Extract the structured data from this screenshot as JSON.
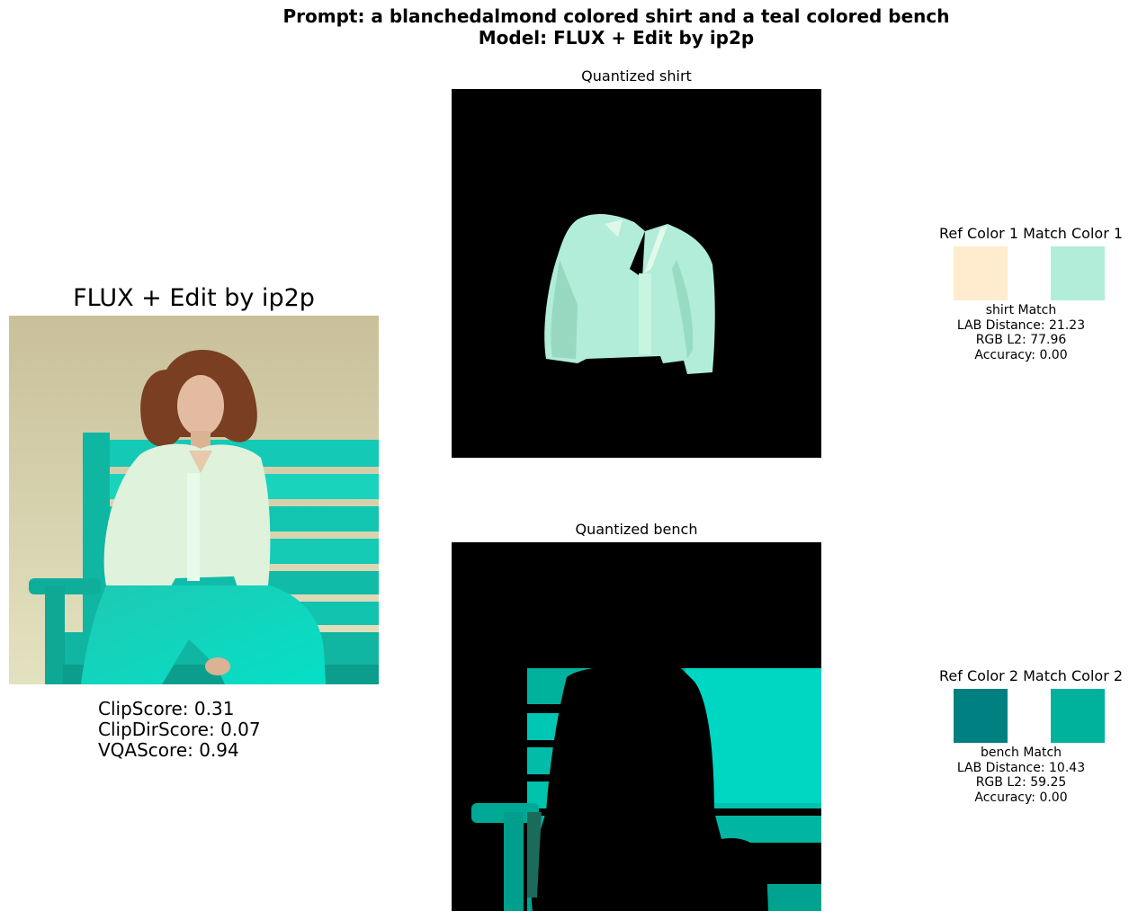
{
  "header": {
    "prompt_line": "Prompt: a blanchedalmond colored shirt and a teal colored bench",
    "model_line": "Model: FLUX + Edit by ip2p"
  },
  "left_panel": {
    "title": "FLUX + Edit by ip2p",
    "scores": [
      "ClipScore: 0.31",
      "ClipDirScore: 0.07",
      "VQAScore: 0.94"
    ]
  },
  "quantized": {
    "shirt_title": "Quantized shirt",
    "bench_title": "Quantized bench"
  },
  "colors": {
    "blanchedalmond": "#FFEBCD",
    "shirt_match": "#B1EDD8",
    "teal": "#008080",
    "bench_match": "#00B19C",
    "bench_cyan": "#00D7C3",
    "wall": "#DCDCB4",
    "hair": "#7A3E22"
  },
  "match_1": {
    "header_ref": "Ref Color 1",
    "header_match": "Match Color 1",
    "label": "shirt Match",
    "lab": "LAB Distance: 21.23",
    "rgb": "RGB L2: 77.96",
    "acc": "Accuracy: 0.00"
  },
  "match_2": {
    "header_ref": "Ref Color 2",
    "header_match": "Match Color 2",
    "label": "bench Match",
    "lab": "LAB Distance: 10.43",
    "rgb": "RGB L2: 59.25",
    "acc": "Accuracy: 0.00"
  }
}
